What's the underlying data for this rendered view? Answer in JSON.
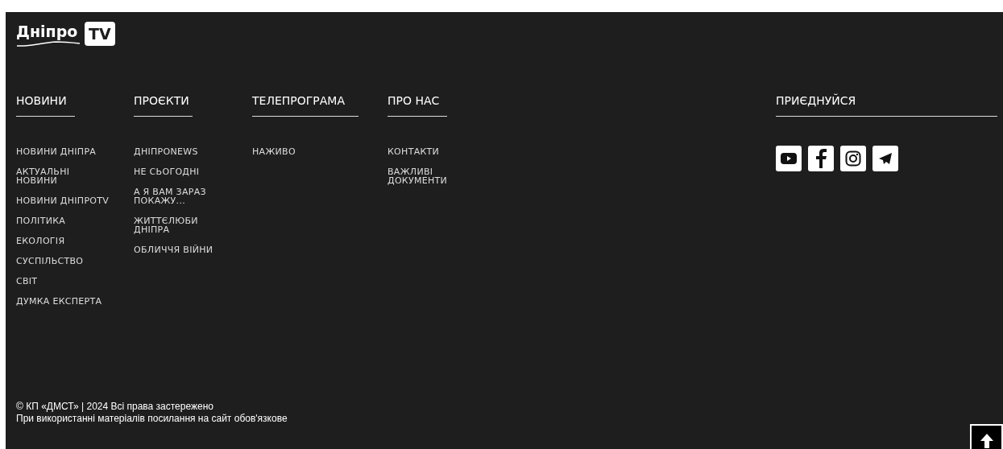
{
  "logo": {
    "name": "Дніпро",
    "badge": "TV"
  },
  "columns": [
    {
      "heading": "НОВИНИ",
      "items": [
        "НОВИНИ ДНІПРА",
        "АКТУАЛЬНІ НОВИНИ",
        "НОВИНИ ДНІПРОTV",
        "ПОЛІТИКА",
        "ЕКОЛОГІЯ",
        "СУСПІЛЬСТВО",
        "СВІТ",
        "ДУМКА ЕКСПЕРТА"
      ]
    },
    {
      "heading": "ПРОЄКТИ",
      "items": [
        "ДНІПРОNEWS",
        "НЕ СЬОГОДНІ",
        "А Я ВАМ ЗАРАЗ ПОКАЖУ...",
        "ЖИТТЄЛЮБИ ДНІПРА",
        "ОБЛИЧЧЯ ВІЙНИ"
      ]
    },
    {
      "heading": "ТЕЛЕПРОГРАМА",
      "items": [
        "НАЖИВО"
      ]
    },
    {
      "heading": "ПРО НАС",
      "items": [
        "КОНТАКТИ",
        "ВАЖЛИВІ ДОКУМЕНТИ"
      ]
    }
  ],
  "social": {
    "heading": "ПРИЄДНУЙСЯ",
    "links": [
      {
        "kind": "youtube"
      },
      {
        "kind": "facebook"
      },
      {
        "kind": "instagram"
      },
      {
        "kind": "telegram"
      }
    ]
  },
  "copyright": [
    "© КП «ДМСТ» | 2024 Всі права застережено",
    "При використанні матеріалів посилання на сайт обов'язкове"
  ]
}
